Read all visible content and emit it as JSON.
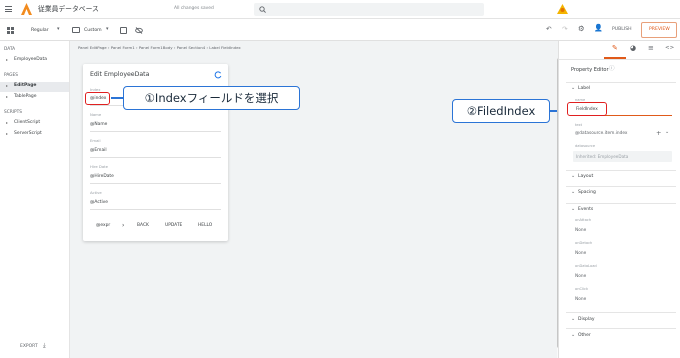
{
  "app": {
    "title": "従業員データベース",
    "save_status": "All changes saved"
  },
  "toolbar": {
    "theme": "Regular",
    "size": "Custom",
    "publish": "PUBLISH",
    "preview": "PREVIEW"
  },
  "breadcrumb": "Panel EditPage › Panel Form1 › Panel Form1Body › Panel Section4 › Label FieldIndex",
  "sidebar": {
    "data_header": "DATA",
    "data_items": [
      {
        "label": "EmployeeData"
      }
    ],
    "pages_header": "PAGES",
    "pages_items": [
      {
        "label": "EditPage"
      },
      {
        "label": "TablePage"
      }
    ],
    "scripts_header": "SCRIPTS",
    "scripts_items": [
      {
        "label": "ClientScript"
      },
      {
        "label": "ServerScript"
      }
    ],
    "export": "EXPORT"
  },
  "form": {
    "title": "Edit EmployeeData",
    "fields": [
      {
        "label": "Index",
        "value": "@index"
      },
      {
        "label": "Name",
        "value": "@Name"
      },
      {
        "label": "Email",
        "value": "@Email"
      },
      {
        "label": "Hire Date",
        "value": "@HireDate"
      },
      {
        "label": "Active",
        "value": "@Active"
      }
    ],
    "buttons": {
      "expr": "@expr",
      "back": "BACK",
      "update": "UPDATE",
      "hello": "HELLO"
    }
  },
  "callouts": {
    "one": "①Indexフィールドを選択",
    "two": "②FiledIndex"
  },
  "property_editor": {
    "title": "Property Editor",
    "label_section": "Label",
    "name_sub": "name",
    "name_value": "FieldIndex",
    "text_sub": "text",
    "text_value": "@datasource.item.index",
    "datasource_sub": "datasource",
    "datasource_value": "Inherited: EmployeeData",
    "layout": "Layout",
    "spacing": "Spacing",
    "events": "Events",
    "event_items": [
      {
        "name": "onAttach",
        "value": "None"
      },
      {
        "name": "onDetach",
        "value": "None"
      },
      {
        "name": "onDataLoad",
        "value": "None"
      },
      {
        "name": "onClick",
        "value": "None"
      }
    ],
    "display": "Display",
    "other": "Other"
  }
}
